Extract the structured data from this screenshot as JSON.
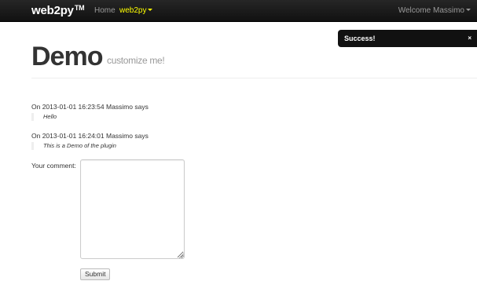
{
  "navbar": {
    "brand": "web2py",
    "brand_mark": "TM",
    "home": "Home",
    "web2py_menu": "web2py",
    "welcome": "Welcome Massimo"
  },
  "flash": {
    "message": "Success!",
    "close": "×"
  },
  "header": {
    "title": "Demo",
    "subtitle": "customize me!"
  },
  "comments": [
    {
      "meta": "On 2013-01-01 16:23:54 Massimo says",
      "body": "Hello"
    },
    {
      "meta": "On 2013-01-01 16:24:01 Massimo says",
      "body": "This is a Demo of the plugin"
    }
  ],
  "form": {
    "label": "Your comment:",
    "value": "",
    "submit": "Submit"
  },
  "colors": {
    "navbar_bg": "#1b1b1b",
    "active_menu": "#ffff00",
    "flash_bg": "#111111"
  }
}
